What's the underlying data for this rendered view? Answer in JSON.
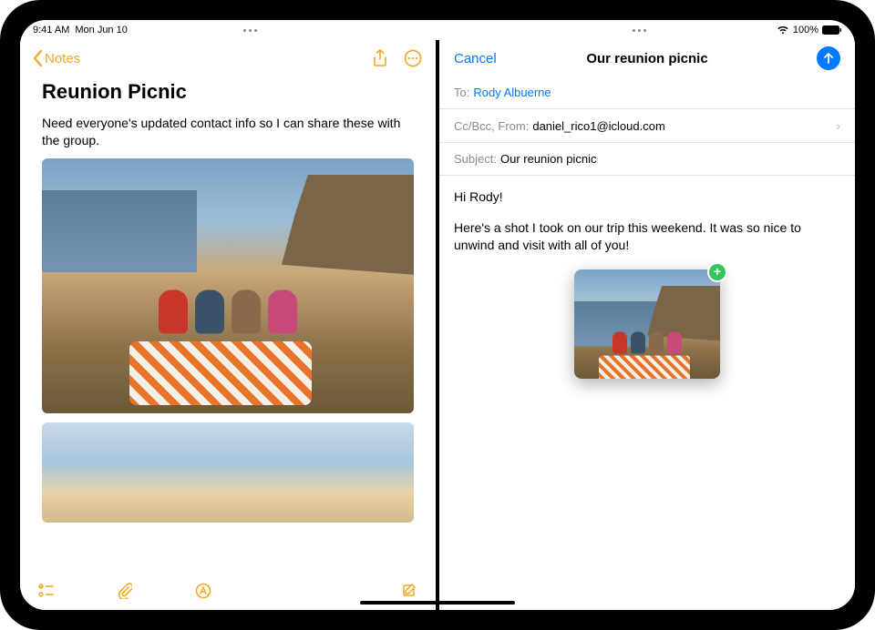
{
  "statusbar": {
    "time": "9:41 AM",
    "date": "Mon Jun 10",
    "battery_pct": "100%"
  },
  "notes": {
    "back_label": "Notes",
    "title": "Reunion Picnic",
    "body_line": "Need everyone's updated contact info so I can share these with the group."
  },
  "mail": {
    "cancel_label": "Cancel",
    "title": "Our reunion picnic",
    "to_label": "To:",
    "to_value": "Rody Albuerne",
    "ccbcc_label": "Cc/Bcc, From:",
    "from_value": "daniel_rico1@icloud.com",
    "subject_label": "Subject:",
    "subject_value": "Our reunion picnic",
    "body_greeting": "Hi Rody!",
    "body_text": "Here's a shot I took on our trip this weekend. It was so nice to unwind and visit with all of you!"
  }
}
